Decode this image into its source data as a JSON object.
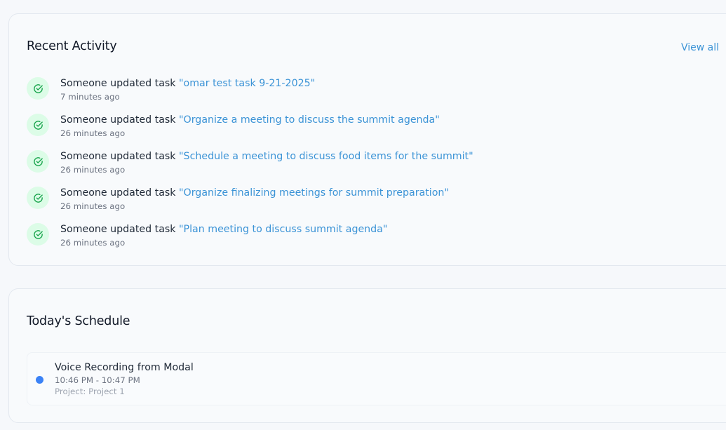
{
  "recent_activity": {
    "title": "Recent Activity",
    "view_all_label": "View all",
    "items": [
      {
        "icon": "check-circle-icon",
        "prefix": "Someone updated task ",
        "task": "\"omar test task 9-21-2025\"",
        "time": "7 minutes ago"
      },
      {
        "icon": "check-circle-icon",
        "prefix": "Someone updated task ",
        "task": "\"Organize a meeting to discuss the summit agenda\"",
        "time": "26 minutes ago"
      },
      {
        "icon": "check-circle-icon",
        "prefix": "Someone updated task ",
        "task": "\"Schedule a meeting to discuss food items for the summit\"",
        "time": "26 minutes ago"
      },
      {
        "icon": "check-circle-icon",
        "prefix": "Someone updated task ",
        "task": "\"Organize finalizing meetings for summit preparation\"",
        "time": "26 minutes ago"
      },
      {
        "icon": "check-circle-icon",
        "prefix": "Someone updated task ",
        "task": "\"Plan meeting to discuss summit agenda\"",
        "time": "26 minutes ago"
      }
    ]
  },
  "schedule": {
    "title": "Today's Schedule",
    "items": [
      {
        "title": "Voice Recording from Modal",
        "time": "10:46 PM - 10:47 PM",
        "project": "Project: Project 1",
        "dot_color": "#3b82f6"
      }
    ]
  },
  "colors": {
    "accent_link": "#3b93d6",
    "success_bg": "#dcfce7",
    "success_icon": "#16a34a",
    "event_dot": "#3b82f6"
  }
}
